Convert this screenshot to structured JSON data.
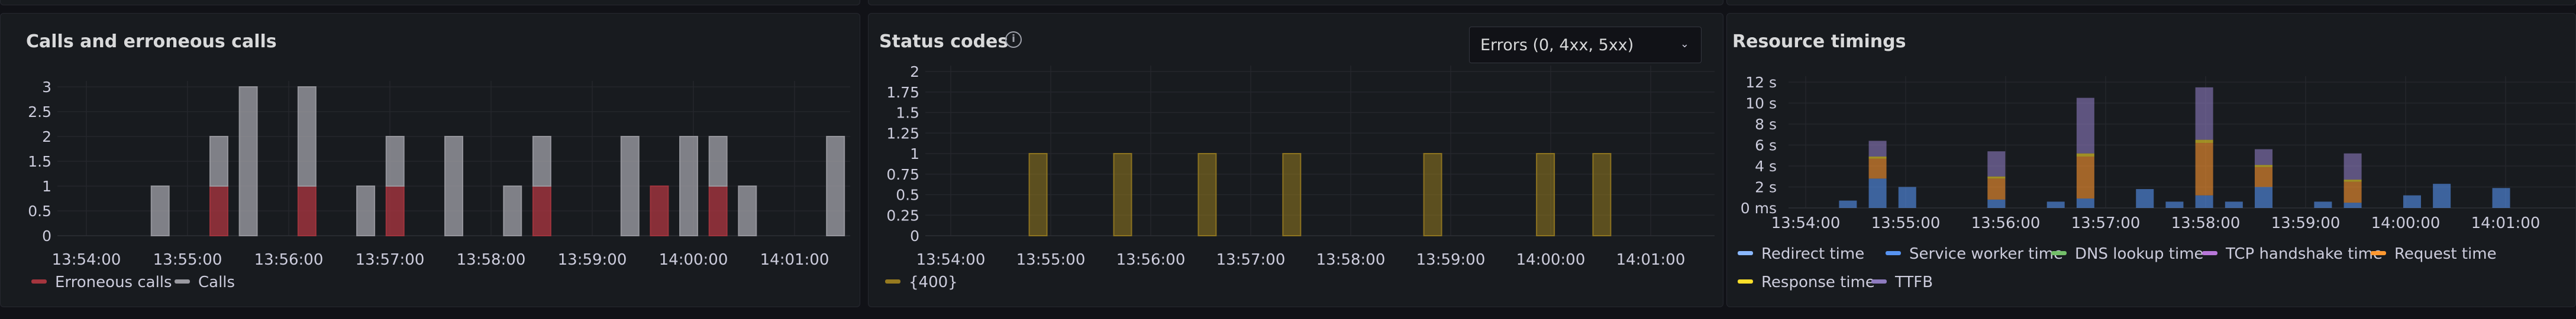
{
  "panels": [
    {
      "title": "Calls and erroneous calls",
      "chart_data": {
        "type": "bar",
        "stacked": true,
        "x": [
          "13:53:20",
          "13:53:40",
          "13:54:00",
          "13:54:20",
          "13:54:40",
          "13:55:00",
          "13:55:20",
          "13:55:40",
          "13:56:00",
          "13:56:20",
          "13:56:40",
          "13:57:00",
          "13:57:20",
          "13:57:40",
          "13:58:00",
          "13:58:20",
          "13:58:40",
          "13:59:00",
          "13:59:20",
          "13:59:40",
          "14:00:00",
          "14:00:20",
          "14:00:40",
          "14:01:00",
          "14:01:20",
          "14:01:40",
          "14:02:00"
        ],
        "series": [
          {
            "name": "Erroneous calls",
            "color": "#a5353e",
            "values": [
              0,
              0,
              0,
              0,
              0,
              1,
              0,
              0,
              1,
              0,
              0,
              1,
              0,
              0,
              0,
              0,
              1,
              0,
              0,
              0,
              1,
              0,
              1,
              0,
              0,
              0,
              0
            ]
          },
          {
            "name": "Calls",
            "color": "#9a9aa1",
            "values": [
              0,
              0,
              0,
              1,
              0,
              1,
              3,
              0,
              2,
              0,
              1,
              1,
              0,
              2,
              0,
              1,
              1,
              0,
              0,
              2,
              0,
              2,
              1,
              1,
              0,
              0,
              2
            ]
          }
        ],
        "yticks": [
          "0",
          "0.5",
          "1",
          "1.5",
          "2",
          "2.5",
          "3"
        ],
        "ylim": [
          0,
          3
        ],
        "xticks": [
          "13:54:00",
          "13:55:00",
          "13:56:00",
          "13:57:00",
          "13:58:00",
          "13:59:00",
          "14:00:00",
          "14:01:00"
        ],
        "legend": "bottom-left",
        "grid": true
      }
    },
    {
      "title": "Status codes",
      "info_icon": "info-icon",
      "dropdown": {
        "value": "Errors (0, 4xx, 5xx)",
        "icon": "chevron-down-icon"
      },
      "chart_data": {
        "type": "bar",
        "x": [
          "13:54:20",
          "13:55:20",
          "13:56:20",
          "13:57:20",
          "13:59:00",
          "14:00:20",
          "14:01:00"
        ],
        "series": [
          {
            "name": "{400}",
            "color": "#967a1f",
            "values": [
              1,
              1,
              1,
              1,
              1,
              1,
              1
            ]
          }
        ],
        "yticks": [
          "0",
          "0.25",
          "0.5",
          "0.75",
          "1",
          "1.25",
          "1.5",
          "1.75",
          "2"
        ],
        "ylim": [
          0,
          2
        ],
        "xticks": [
          "13:54:00",
          "13:55:00",
          "13:56:00",
          "13:57:00",
          "13:58:00",
          "13:59:00",
          "14:00:00",
          "14:01:00"
        ],
        "legend": "bottom-left",
        "grid": true
      }
    },
    {
      "title": "Resource timings",
      "chart_data": {
        "type": "bar",
        "stacked": true,
        "x": [
          "13:54:00",
          "13:54:20",
          "13:54:40",
          "13:55:40",
          "13:56:20",
          "13:56:40",
          "13:57:20",
          "13:57:40",
          "13:58:00",
          "13:58:20",
          "13:58:40",
          "13:59:20",
          "13:59:40",
          "14:00:20",
          "14:00:40",
          "14:01:20",
          "14:02:00"
        ],
        "series": [
          {
            "name": "Redirect time",
            "color": "#8ab8ff",
            "values": [
              0,
              0,
              0,
              0,
              0,
              0,
              0,
              0,
              0,
              0,
              0,
              0,
              0,
              0,
              0,
              0,
              0
            ]
          },
          {
            "name": "Service worker time",
            "color": "#5794f2",
            "values": [
              0.7,
              2.8,
              2.0,
              0.8,
              0.6,
              0.9,
              1.8,
              0.6,
              1.2,
              0.6,
              2.0,
              0.6,
              0.5,
              1.2,
              2.3,
              1.9,
              0
            ]
          },
          {
            "name": "DNS lookup time",
            "color": "#73bf69",
            "values": [
              0,
              0,
              0,
              0,
              0,
              0,
              0,
              0,
              0,
              0,
              0,
              0,
              0,
              0,
              0,
              0,
              0
            ]
          },
          {
            "name": "TCP handshake time",
            "color": "#b877d9",
            "values": [
              0,
              0,
              0,
              0,
              0,
              0,
              0,
              0,
              0,
              0,
              0,
              0,
              0,
              0,
              0,
              0,
              0
            ]
          },
          {
            "name": "Request time",
            "color": "#ff9830",
            "values": [
              0,
              1.9,
              0,
              2.0,
              0,
              4.0,
              0,
              0,
              5.0,
              0,
              1.9,
              0,
              2.0,
              0,
              0,
              0,
              0
            ]
          },
          {
            "name": "Response time",
            "color": "#fade2a",
            "values": [
              0,
              0.2,
              0,
              0.2,
              0,
              0.3,
              0,
              0,
              0.3,
              0,
              0.2,
              0,
              0.2,
              0,
              0,
              0,
              0
            ]
          },
          {
            "name": "TTFB",
            "color": "#8e7bbf",
            "values": [
              0,
              1.5,
              0,
              2.4,
              0,
              5.3,
              0,
              0,
              5.0,
              0,
              1.5,
              0,
              2.5,
              0,
              0,
              0,
              0
            ]
          }
        ],
        "yticks": [
          "0 ms",
          "2 s",
          "4 s",
          "6 s",
          "8 s",
          "10 s",
          "12 s"
        ],
        "ylim": [
          0,
          12
        ],
        "xticks": [
          "13:54:00",
          "13:55:00",
          "13:56:00",
          "13:57:00",
          "13:58:00",
          "13:59:00",
          "14:00:00",
          "14:01:00"
        ],
        "legend": "bottom-left",
        "grid": true
      }
    }
  ]
}
